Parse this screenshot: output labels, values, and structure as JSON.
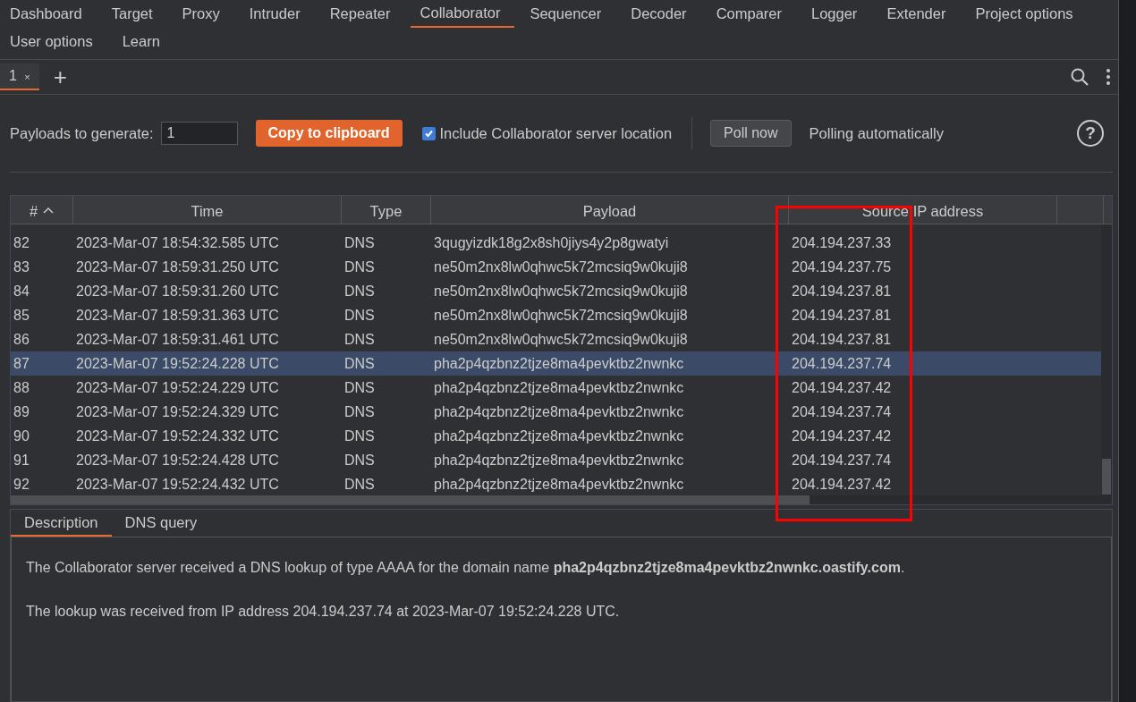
{
  "tab_rows": [
    [
      {
        "label": "Dashboard",
        "selected": false
      },
      {
        "label": "Target",
        "selected": false
      },
      {
        "label": "Proxy",
        "selected": false
      },
      {
        "label": "Intruder",
        "selected": false
      },
      {
        "label": "Repeater",
        "selected": false
      },
      {
        "label": "Collaborator",
        "selected": true
      },
      {
        "label": "Sequencer",
        "selected": false
      },
      {
        "label": "Decoder",
        "selected": false
      },
      {
        "label": "Comparer",
        "selected": false
      },
      {
        "label": "Logger",
        "selected": false
      },
      {
        "label": "Extender",
        "selected": false
      },
      {
        "label": "Project options",
        "selected": false
      }
    ],
    [
      {
        "label": "User options",
        "selected": false
      },
      {
        "label": "Learn",
        "selected": false
      }
    ]
  ],
  "sub_tabs": [
    {
      "label": "1",
      "close": "×",
      "selected": true
    }
  ],
  "add_tab": "+",
  "controls": {
    "payloads_label": "Payloads to generate:",
    "payloads_value": "1",
    "copy_button": "Copy to clipboard",
    "include_location": {
      "label": "Include Collaborator server location",
      "checked": true
    },
    "poll_button": "Poll now",
    "status": "Polling automatically",
    "help": "?"
  },
  "table": {
    "columns": [
      {
        "label": "#",
        "sorted": true
      },
      {
        "label": "Time",
        "sorted": false
      },
      {
        "label": "Type",
        "sorted": false
      },
      {
        "label": "Payload",
        "sorted": false
      },
      {
        "label": "Source IP address",
        "sorted": false
      }
    ],
    "rows": [
      {
        "cells": [
          "82",
          "2023-Mar-07 18:54:32.585 UTC",
          "DNS",
          "3qugyizdk18g2x8sh0jiys4y2p8gwatyi",
          "204.194.237.33"
        ],
        "selected": false
      },
      {
        "cells": [
          "83",
          "2023-Mar-07 18:59:31.250 UTC",
          "DNS",
          "ne50m2nx8lw0qhwc5k72mcsiq9w0kuji8",
          "204.194.237.75"
        ],
        "selected": false
      },
      {
        "cells": [
          "84",
          "2023-Mar-07 18:59:31.260 UTC",
          "DNS",
          "ne50m2nx8lw0qhwc5k72mcsiq9w0kuji8",
          "204.194.237.81"
        ],
        "selected": false
      },
      {
        "cells": [
          "85",
          "2023-Mar-07 18:59:31.363 UTC",
          "DNS",
          "ne50m2nx8lw0qhwc5k72mcsiq9w0kuji8",
          "204.194.237.81"
        ],
        "selected": false
      },
      {
        "cells": [
          "86",
          "2023-Mar-07 18:59:31.461 UTC",
          "DNS",
          "ne50m2nx8lw0qhwc5k72mcsiq9w0kuji8",
          "204.194.237.81"
        ],
        "selected": false
      },
      {
        "cells": [
          "87",
          "2023-Mar-07 19:52:24.228 UTC",
          "DNS",
          "pha2p4qzbnz2tjze8ma4pevktbz2nwnkc",
          "204.194.237.74"
        ],
        "selected": true
      },
      {
        "cells": [
          "88",
          "2023-Mar-07 19:52:24.229 UTC",
          "DNS",
          "pha2p4qzbnz2tjze8ma4pevktbz2nwnkc",
          "204.194.237.42"
        ],
        "selected": false
      },
      {
        "cells": [
          "89",
          "2023-Mar-07 19:52:24.329 UTC",
          "DNS",
          "pha2p4qzbnz2tjze8ma4pevktbz2nwnkc",
          "204.194.237.74"
        ],
        "selected": false
      },
      {
        "cells": [
          "90",
          "2023-Mar-07 19:52:24.332 UTC",
          "DNS",
          "pha2p4qzbnz2tjze8ma4pevktbz2nwnkc",
          "204.194.237.42"
        ],
        "selected": false
      },
      {
        "cells": [
          "91",
          "2023-Mar-07 19:52:24.428 UTC",
          "DNS",
          "pha2p4qzbnz2tjze8ma4pevktbz2nwnkc",
          "204.194.237.74"
        ],
        "selected": false
      },
      {
        "cells": [
          "92",
          "2023-Mar-07 19:52:24.432 UTC",
          "DNS",
          "pha2p4qzbnz2tjze8ma4pevktbz2nwnkc",
          "204.194.237.42"
        ],
        "selected": false
      }
    ]
  },
  "detail": {
    "tabs": [
      {
        "label": "Description",
        "selected": true
      },
      {
        "label": "DNS query",
        "selected": false
      }
    ],
    "paragraphs": [
      "The Collaborator server received a DNS lookup of type AAAA for the domain name **pha2p4qzbnz2tjze8ma4pevktbz2nwnkc.oastify.com**.",
      "The lookup was received from IP address 204.194.237.74 at 2023-Mar-07 19:52:24.228 UTC."
    ]
  }
}
